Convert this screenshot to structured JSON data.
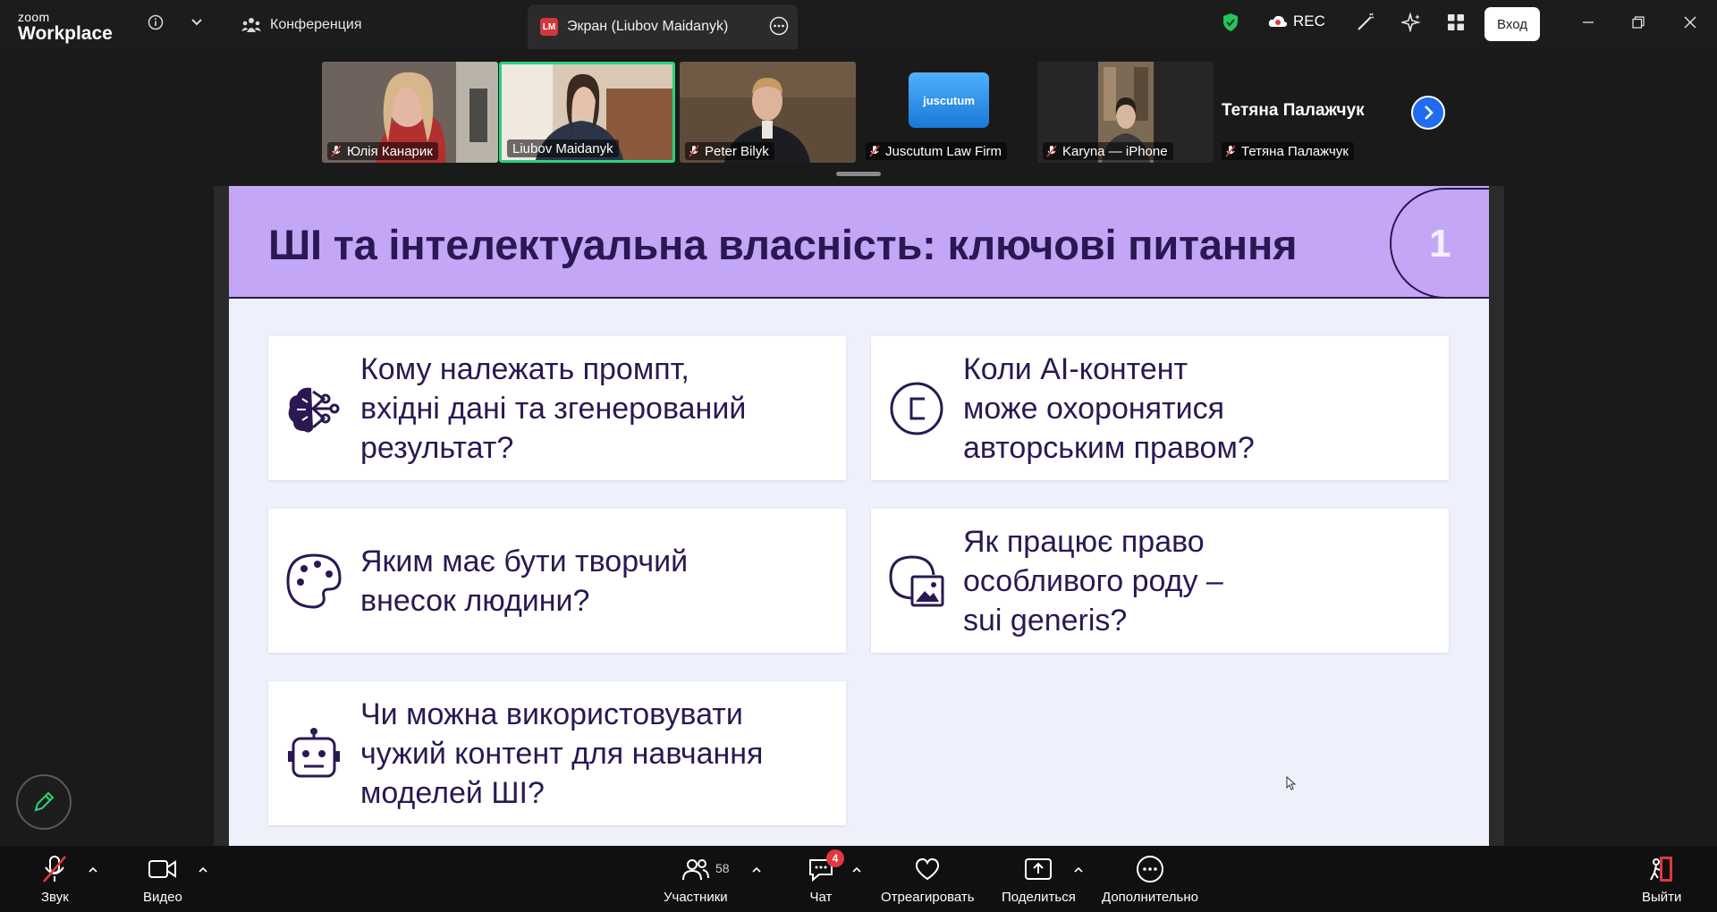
{
  "app": {
    "logo_line1": "zoom",
    "logo_line2": "Workplace"
  },
  "tabs": {
    "conference": "Конференция",
    "screen_badge": "LM",
    "screen": "Экран (Liubov Maidanyk)"
  },
  "topbar": {
    "rec_label": "REC",
    "login_label": "Вход"
  },
  "participants": [
    {
      "name": "Юлія Канарик",
      "muted": true,
      "active": false
    },
    {
      "name": "Liubov Maidanyk",
      "muted": false,
      "active": true
    },
    {
      "name": "Peter Bilyk",
      "muted": true,
      "active": false
    },
    {
      "name": "Juscutum Law Firm",
      "muted": true,
      "active": false,
      "logo_text": "juscutum"
    },
    {
      "name": "Karyna — iPhone",
      "muted": true,
      "active": false
    },
    {
      "name": "Тетяна Палажчук",
      "muted": true,
      "active": false
    }
  ],
  "featured_name": "Тетяна Палажчук",
  "slide": {
    "title": "ШІ та інтелектуальна власність: ключові питання",
    "number": "1",
    "cards": [
      {
        "icon": "brain-network-icon",
        "lines": [
          "Кому належать промпт,",
          "вхідні дані та згенерований",
          "результат?"
        ]
      },
      {
        "icon": "copyright-icon",
        "lines": [
          "Коли AI-контент",
          "може охоронятися",
          "авторським правом?"
        ]
      },
      {
        "icon": "palette-icon",
        "lines": [
          "Яким має бути творчий",
          "внесок людини?"
        ]
      },
      {
        "icon": "image-shapes-icon",
        "lines": [
          "Як працює право",
          "особливого роду –",
          "sui generis?"
        ]
      },
      {
        "icon": "robot-icon",
        "lines": [
          "Чи можна використовувати",
          "чужий контент для навчання",
          "моделей ШІ?"
        ]
      }
    ]
  },
  "toolbar": {
    "audio": "Звук",
    "video": "Видео",
    "participants": "Участники",
    "participants_count": "58",
    "chat": "Чат",
    "chat_badge": "4",
    "react": "Отреагировать",
    "share": "Поделиться",
    "more": "Дополнительно",
    "leave": "Выйти"
  },
  "colors": {
    "slide_header": "#c4a6f6",
    "slide_text": "#2b1852",
    "active_speaker": "#2ad37c",
    "accent_blue": "#1f6cf0",
    "leave_red": "#e0383e"
  }
}
